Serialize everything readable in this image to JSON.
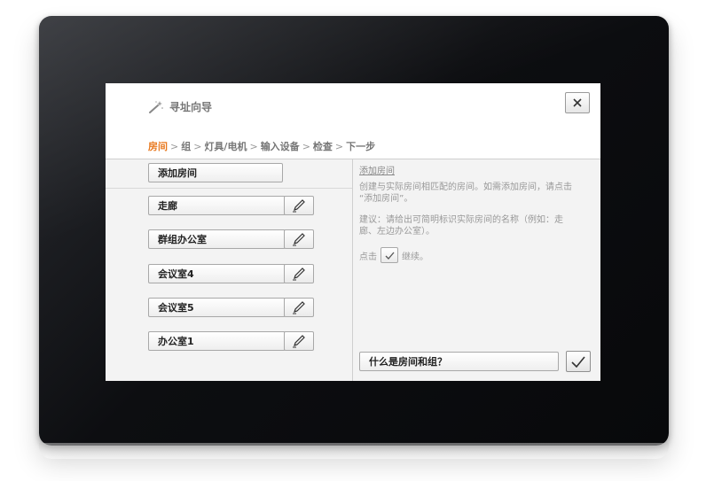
{
  "wizard": {
    "title": "寻址向导",
    "icon": "magic-wand-icon",
    "close_icon": "close-icon"
  },
  "breadcrumb": {
    "steps": [
      "房间",
      "组",
      "灯具/电机",
      "输入设备",
      "检查",
      "下一步"
    ],
    "separator": ">",
    "active_color": "#e8781e"
  },
  "rooms": {
    "add_label": "添加房间",
    "items": [
      "走廊",
      "群组办公室",
      "会议室4",
      "会议室5",
      "办公室1"
    ],
    "edit_icon": "pencil-icon"
  },
  "info": {
    "title": "添加房间",
    "paragraph1": "创建与实际房间相匹配的房间。如需添加房间，请点击 “添加房间”。",
    "paragraph2": "建议：请给出可简明标识实际房间的名称（例如：走廊、左边办公室）。",
    "continue_prefix": "点击",
    "continue_suffix": "继续。",
    "check_icon": "checkmark-icon"
  },
  "footer": {
    "help_label": "什么是房间和组？",
    "confirm_icon": "checkmark-icon"
  }
}
